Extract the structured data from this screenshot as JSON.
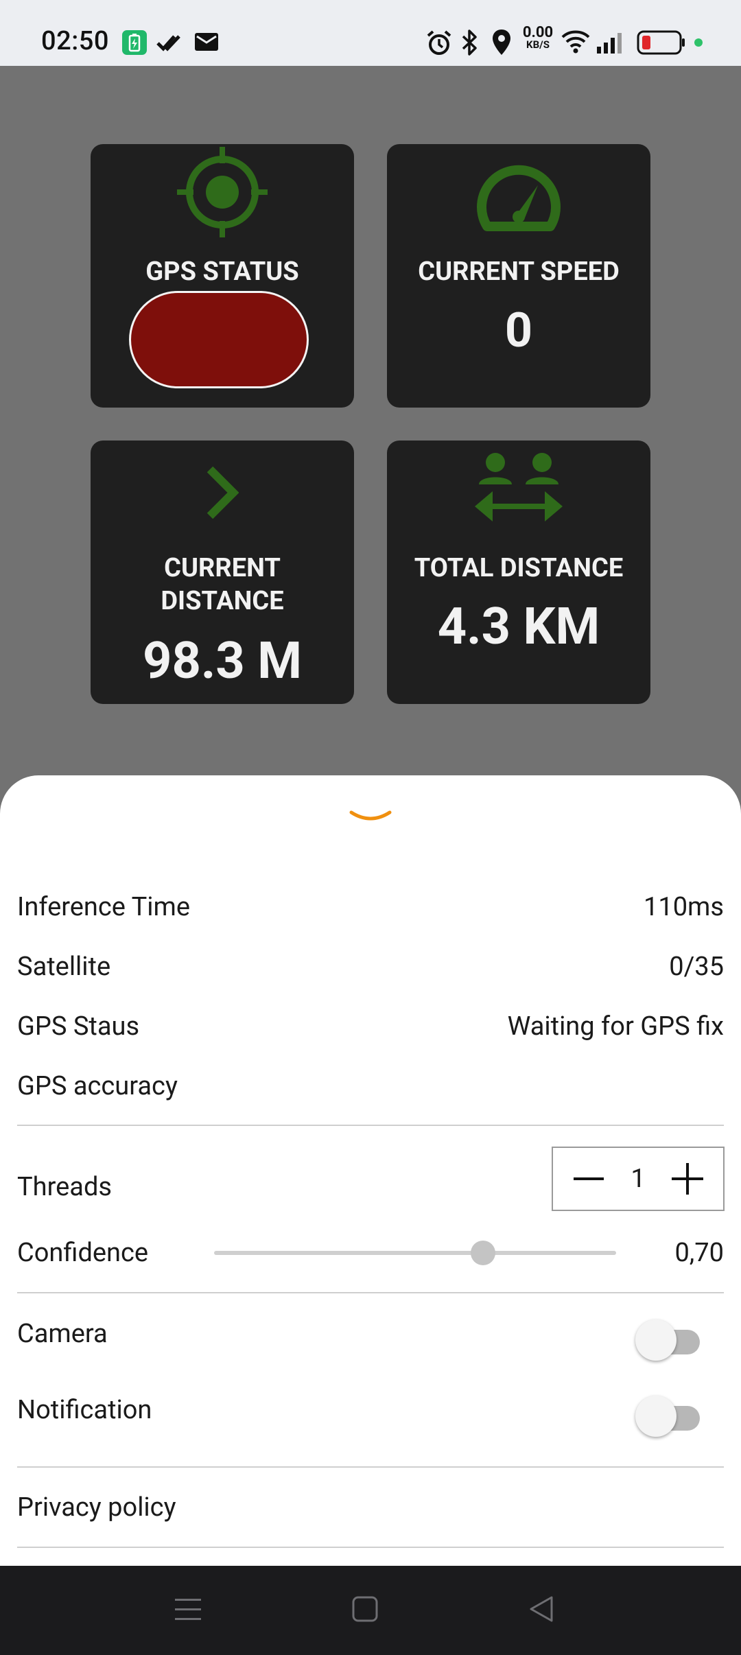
{
  "status_bar": {
    "time": "02:50",
    "net_speed_value": "0.00",
    "net_speed_unit": "KB/S",
    "icons": [
      "battery-saver-icon",
      "done-all-icon",
      "mail-icon",
      "alarm-icon",
      "bluetooth-icon",
      "location-icon",
      "wifi-icon",
      "signal-icon",
      "battery-low-icon",
      "privacy-dot-icon"
    ]
  },
  "cards": {
    "gps_status": {
      "title": "GPS STATUS",
      "icon": "crosshair-icon",
      "status_color": "#7e0f0b"
    },
    "current_speed": {
      "title": "CURRENT SPEED",
      "value": "0",
      "icon": "speedometer-icon"
    },
    "current_distance": {
      "title_line1": "CURRENT",
      "title_line2": "DISTANCE",
      "value": "98.3 M",
      "icon": "chevron-right-icon"
    },
    "total_distance": {
      "title": "TOTAL DISTANCE",
      "value": "4.3 KM",
      "icon": "people-distance-icon"
    }
  },
  "sheet": {
    "collapse_icon": "chevron-down-icon",
    "inference_time": {
      "label": "Inference Time",
      "value": "110ms"
    },
    "satellite": {
      "label": "Satellite",
      "value": "0/35"
    },
    "gps_status": {
      "label": "GPS Staus",
      "value": "Waiting for GPS fix"
    },
    "gps_accuracy": {
      "label": "GPS accuracy",
      "value": ""
    },
    "threads": {
      "label": "Threads",
      "value": "1"
    },
    "confidence": {
      "label": "Confidence",
      "value": "0,70",
      "level": 0.7
    },
    "camera": {
      "label": "Camera",
      "on": false
    },
    "notification": {
      "label": "Notification",
      "on": false
    },
    "privacy_policy": {
      "label": "Privacy policy"
    }
  },
  "colors": {
    "accent_green": "#2f6b1a",
    "accent_orange": "#f0900f",
    "card_bg": "#1f1f1f",
    "gps_red": "#7e0f0b"
  },
  "nav_bar": {
    "icons": [
      "menu-icon",
      "home-icon",
      "back-icon"
    ]
  }
}
